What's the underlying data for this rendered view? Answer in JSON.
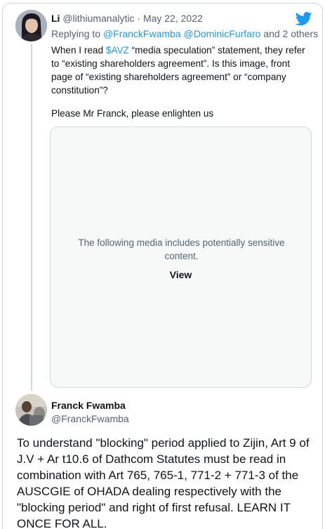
{
  "reply": {
    "author_name": "Li",
    "author_handle": "@lithiumanalytic",
    "separator": "·",
    "date": "May 22, 2022",
    "replying_prefix": "Replying to",
    "replying_users": "@FranckFwamba @DominicFurfaro",
    "replying_suffix": "and 2 others",
    "text_before_cashtag": "When I read",
    "cashtag": "$AVZ",
    "text_after_cashtag": "“media speculation” statement, they refer to “existing shareholders agreement”. Is this image, front page of “existing shareholders agreement” or “company constitution”?",
    "text_second": "Please Mr Franck, please enlighten us",
    "media_warning": "The following media includes potentially sensitive content.",
    "media_view_label": "View"
  },
  "main_tweet": {
    "author_name": "Franck Fwamba",
    "author_handle": "@FranckFwamba",
    "text": "To understand \"blocking\" period applied to Zijin, Art 9 of J.V + Ar t10.6 of Dathcom Statutes must be read in combination with Art 765, 765-1, 771-2 + 771-3 of the AUSCGIE of OHADA dealing respectively with the \"blocking period\" and right of first refusal. LEARN IT ONCE FOR ALL."
  },
  "icons": {
    "brand": "twitter-bird-icon",
    "brand_color": "#1d9bf0"
  }
}
